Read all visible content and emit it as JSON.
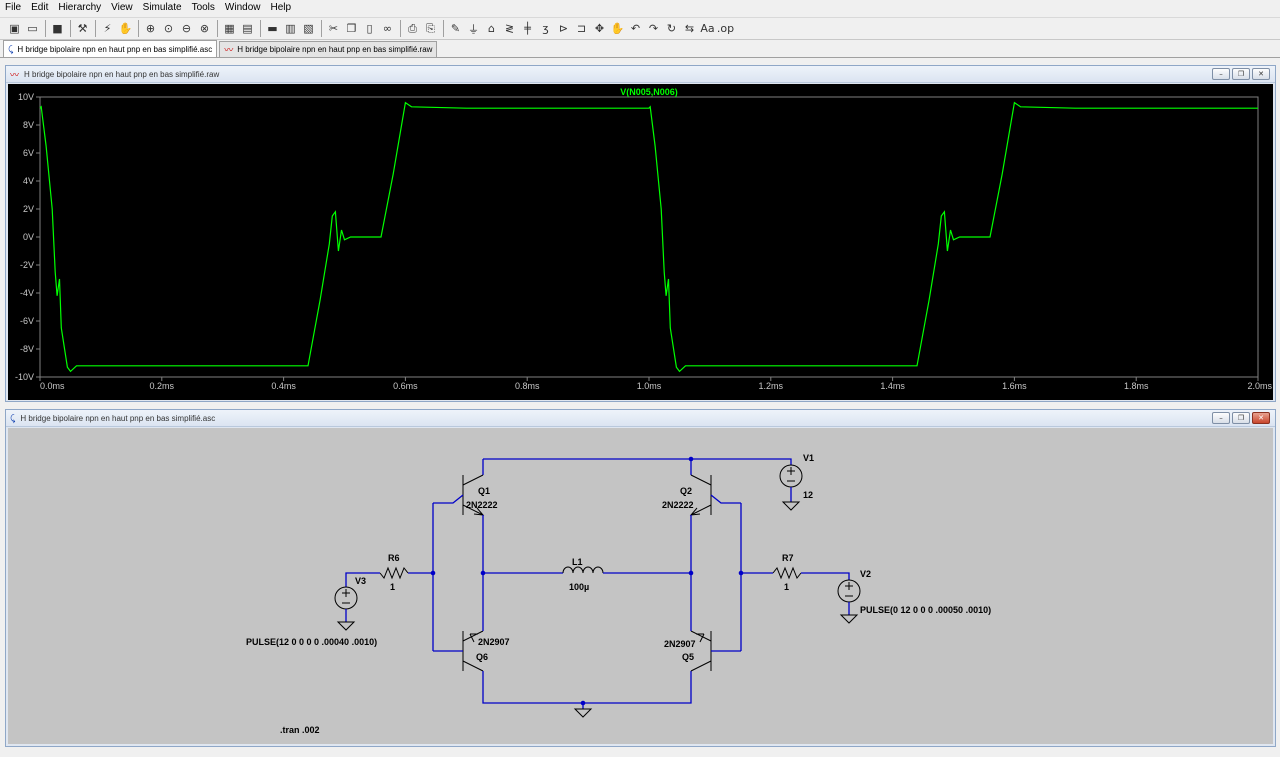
{
  "menu": [
    "File",
    "Edit",
    "Hierarchy",
    "View",
    "Simulate",
    "Tools",
    "Window",
    "Help"
  ],
  "tabs": [
    {
      "label": "H bridge bipolaire npn en haut pnp en bas simplifié.asc",
      "kind": "schematic"
    },
    {
      "label": "H bridge bipolaire npn en haut pnp en bas simplifié.raw",
      "kind": "waveform"
    }
  ],
  "waveform_window": {
    "title": "H bridge bipolaire npn en haut pnp en bas simplifié.raw",
    "trace_label": "V(N005,N006)",
    "trace_color": "#00ff00"
  },
  "schematic_window": {
    "title": "H bridge bipolaire npn en haut pnp en bas simplifié.asc",
    "components": {
      "q1_name": "Q1",
      "q1_model": "2N2222",
      "q2_name": "Q2",
      "q2_model": "2N2222",
      "q5_name": "Q5",
      "q5_model": "2N2907",
      "q6_name": "Q6",
      "q6_model": "2N2907",
      "l1_name": "L1",
      "l1_value": "100µ",
      "r6_name": "R6",
      "r6_value": "1",
      "r7_name": "R7",
      "r7_value": "1",
      "v1_name": "V1",
      "v1_value": "12",
      "v2_name": "V2",
      "v2_value": "PULSE(0 12 0 0 0 .00050 .0010)",
      "v3_name": "V3",
      "v3_value": "PULSE(12 0 0 0 0 .00040 .0010)"
    },
    "directive": ".tran .002"
  },
  "chart_data": {
    "type": "line",
    "title": "V(N005,N006)",
    "xlabel": "",
    "ylabel": "",
    "xlim": [
      0,
      2.0
    ],
    "ylim": [
      -10,
      10
    ],
    "x_tick_labels": [
      "0.0ms",
      "0.2ms",
      "0.4ms",
      "0.6ms",
      "0.8ms",
      "1.0ms",
      "1.2ms",
      "1.4ms",
      "1.6ms",
      "1.8ms",
      "2.0ms"
    ],
    "y_tick_labels": [
      "10V",
      "8V",
      "6V",
      "4V",
      "2V",
      "0V",
      "-2V",
      "-4V",
      "-6V",
      "-8V",
      "-10V"
    ],
    "series": [
      {
        "name": "V(N005,N006)",
        "color": "#00ff00",
        "x": [
          0.0,
          0.002,
          0.01,
          0.02,
          0.025,
          0.028,
          0.032,
          0.035,
          0.045,
          0.05,
          0.06,
          0.1,
          0.2,
          0.3,
          0.4,
          0.44,
          0.46,
          0.475,
          0.48,
          0.485,
          0.49,
          0.495,
          0.5,
          0.51,
          0.52,
          0.55,
          0.56,
          0.58,
          0.6,
          0.61,
          0.7,
          0.8,
          0.9,
          1.0,
          1.002,
          1.01,
          1.02,
          1.025,
          1.028,
          1.032,
          1.035,
          1.045,
          1.05,
          1.06,
          1.1,
          1.2,
          1.3,
          1.4,
          1.44,
          1.46,
          1.475,
          1.48,
          1.485,
          1.49,
          1.495,
          1.5,
          1.51,
          1.52,
          1.55,
          1.56,
          1.58,
          1.6,
          1.61,
          1.7,
          1.8,
          1.9,
          2.0
        ],
        "y": [
          9.2,
          9.3,
          6.5,
          2.0,
          -2.5,
          -4.2,
          -3.0,
          -6.5,
          -9.3,
          -9.6,
          -9.2,
          -9.2,
          -9.2,
          -9.2,
          -9.2,
          -9.2,
          -4.5,
          -0.5,
          1.5,
          1.8,
          -1.0,
          0.5,
          -0.2,
          0.0,
          0.0,
          0.0,
          0.0,
          4.5,
          9.6,
          9.3,
          9.2,
          9.2,
          9.2,
          9.2,
          9.3,
          6.5,
          2.0,
          -2.5,
          -4.2,
          -3.0,
          -6.5,
          -9.3,
          -9.6,
          -9.2,
          -9.2,
          -9.2,
          -9.2,
          -9.2,
          -9.2,
          -4.5,
          -0.5,
          1.5,
          1.8,
          -1.0,
          0.5,
          -0.2,
          0.0,
          0.0,
          0.0,
          0.0,
          4.5,
          9.6,
          9.3,
          9.2,
          9.2,
          9.2,
          9.2
        ]
      }
    ],
    "grid": false,
    "background": "#000000"
  }
}
